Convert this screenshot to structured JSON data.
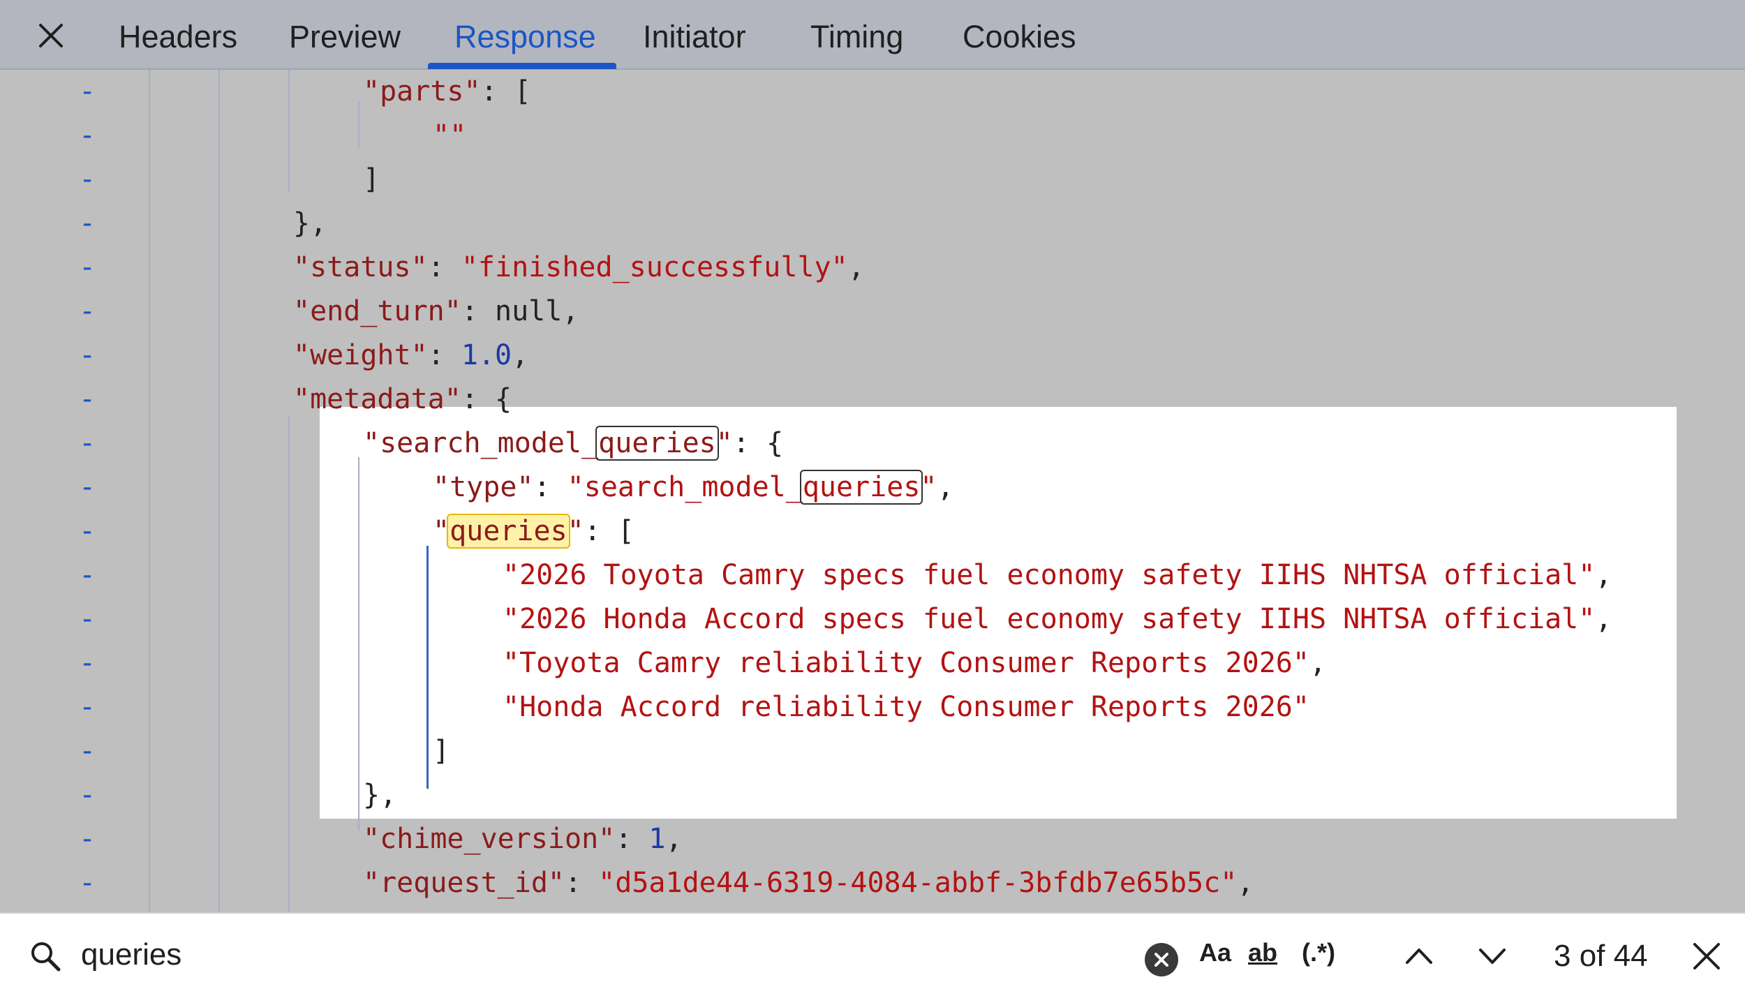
{
  "tabs": [
    {
      "label": "Headers",
      "active": false
    },
    {
      "label": "Preview",
      "active": false
    },
    {
      "label": "Response",
      "active": true
    },
    {
      "label": "Initiator",
      "active": false
    },
    {
      "label": "Timing",
      "active": false
    },
    {
      "label": "Cookies",
      "active": false
    }
  ],
  "code_lines": [
    {
      "marker": "-",
      "text": "\"parts\": ["
    },
    {
      "marker": "-",
      "text": "\"\""
    },
    {
      "marker": "-",
      "text": "]"
    },
    {
      "marker": "-",
      "text": "},"
    },
    {
      "marker": "-",
      "text": "\"status\": \"finished_successfully\","
    },
    {
      "marker": "-",
      "text": "\"end_turn\": null,"
    },
    {
      "marker": "-",
      "text": "\"weight\": 1.0,"
    },
    {
      "marker": "-",
      "text": "\"metadata\": {"
    },
    {
      "marker": "-",
      "text": "\"search_model_queries\": {"
    },
    {
      "marker": "-",
      "text": "\"type\": \"search_model_queries\","
    },
    {
      "marker": "-",
      "text": "\"queries\": ["
    },
    {
      "marker": "-",
      "text": "\"2026 Toyota Camry specs fuel economy safety IIHS NHTSA official\","
    },
    {
      "marker": "-",
      "text": "\"2026 Honda Accord specs fuel economy safety IIHS NHTSA official\","
    },
    {
      "marker": "-",
      "text": "\"Toyota Camry reliability Consumer Reports 2026\","
    },
    {
      "marker": "-",
      "text": "\"Honda Accord reliability Consumer Reports 2026\""
    },
    {
      "marker": "-",
      "text": "]"
    },
    {
      "marker": "-",
      "text": "},"
    },
    {
      "marker": "-",
      "text": "\"chime_version\": 1,"
    },
    {
      "marker": "-",
      "text": "\"request_id\": \"d5a1de44-6319-4084-abbf-3bfdb7e65b5c\","
    }
  ],
  "search": {
    "value": "queries",
    "match_case_label": "Aa",
    "whole_word_label": "ab",
    "regex_label": "(.*)",
    "match_count": "3 of 44"
  },
  "colors": {
    "accent": "#1a56c4",
    "key": "#8b1a1a",
    "string": "#b31212",
    "number": "#1a38a8",
    "current_match": "#fff1a8"
  },
  "icons": [
    "close-icon",
    "search-icon",
    "clear-icon",
    "chevron-up-icon",
    "chevron-down-icon"
  ]
}
